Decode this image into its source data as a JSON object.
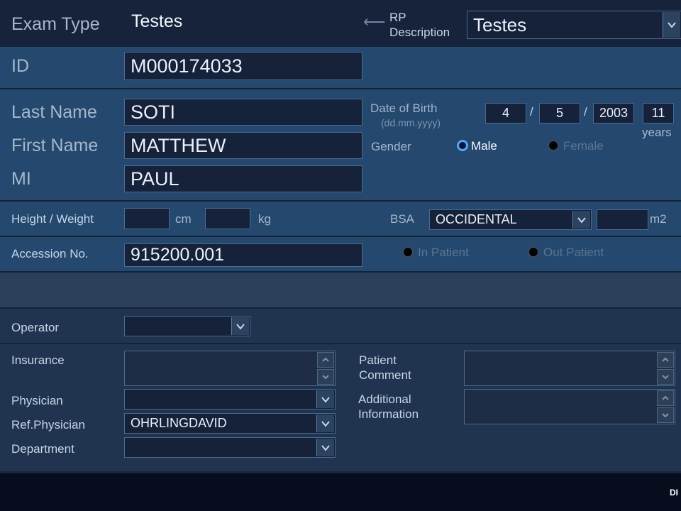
{
  "header": {
    "exam_type_label": "Exam Type",
    "exam_type_value": "Testes",
    "back_arrow_glyph": "⟵",
    "rp_description_label_1": "RP",
    "rp_description_label_2": "Description",
    "rp_description_value": "Testes"
  },
  "id_section": {
    "label": "ID",
    "value": "M000174033"
  },
  "name_section": {
    "last_name_label": "Last Name",
    "last_name_value": "SOTI",
    "first_name_label": "First Name",
    "first_name_value": "MATTHEW",
    "mi_label": "MI",
    "mi_value": "PAUL",
    "dob_label": "Date of Birth",
    "dob_format": "(dd.mm.yyyy)",
    "dob_day": "4",
    "dob_month": "5",
    "dob_year": "2003",
    "dob_sep": "/",
    "age_value": "11",
    "age_unit": "years",
    "gender_label": "Gender",
    "gender_options": [
      "Male",
      "Female"
    ],
    "gender_selected": "Male"
  },
  "measurements": {
    "height_label": "Height",
    "slash": "/",
    "weight_label": "Weight",
    "height_value": "",
    "height_unit": "cm",
    "weight_value": "",
    "weight_unit": "kg",
    "bsa_label": "BSA",
    "bsa_value": "OCCIDENTAL",
    "bsa_result": "",
    "bsa_unit": "m2"
  },
  "accession": {
    "label": "Accession No.",
    "value": "915200.001",
    "patient_type_options": [
      "In Patient",
      "Out Patient"
    ],
    "patient_type_selected": ""
  },
  "operator": {
    "label": "Operator",
    "value": ""
  },
  "details": {
    "insurance_label": "Insurance",
    "insurance_value": "",
    "physician_label": "Physician",
    "physician_value": "",
    "ref_physician_label": "Ref.Physician",
    "ref_physician_value": "OHRLINGDAVID",
    "department_label": "Department",
    "department_value": "",
    "patient_comment_label_1": "Patient",
    "patient_comment_label_2": "Comment",
    "patient_comment_value": "",
    "additional_info_label_1": "Additional",
    "additional_info_label_2": "Information",
    "additional_info_value": ""
  },
  "footer": {
    "text": "DI"
  },
  "icons": {
    "combo": "chevron-down-icon",
    "spin_up": "chevron-up-icon",
    "spin_down": "chevron-down-icon",
    "back": "left-arrow-icon"
  },
  "colors": {
    "accent_radio": "#4fa8ff",
    "panel_mid": "#24486e",
    "field_bg": "#16213a"
  }
}
